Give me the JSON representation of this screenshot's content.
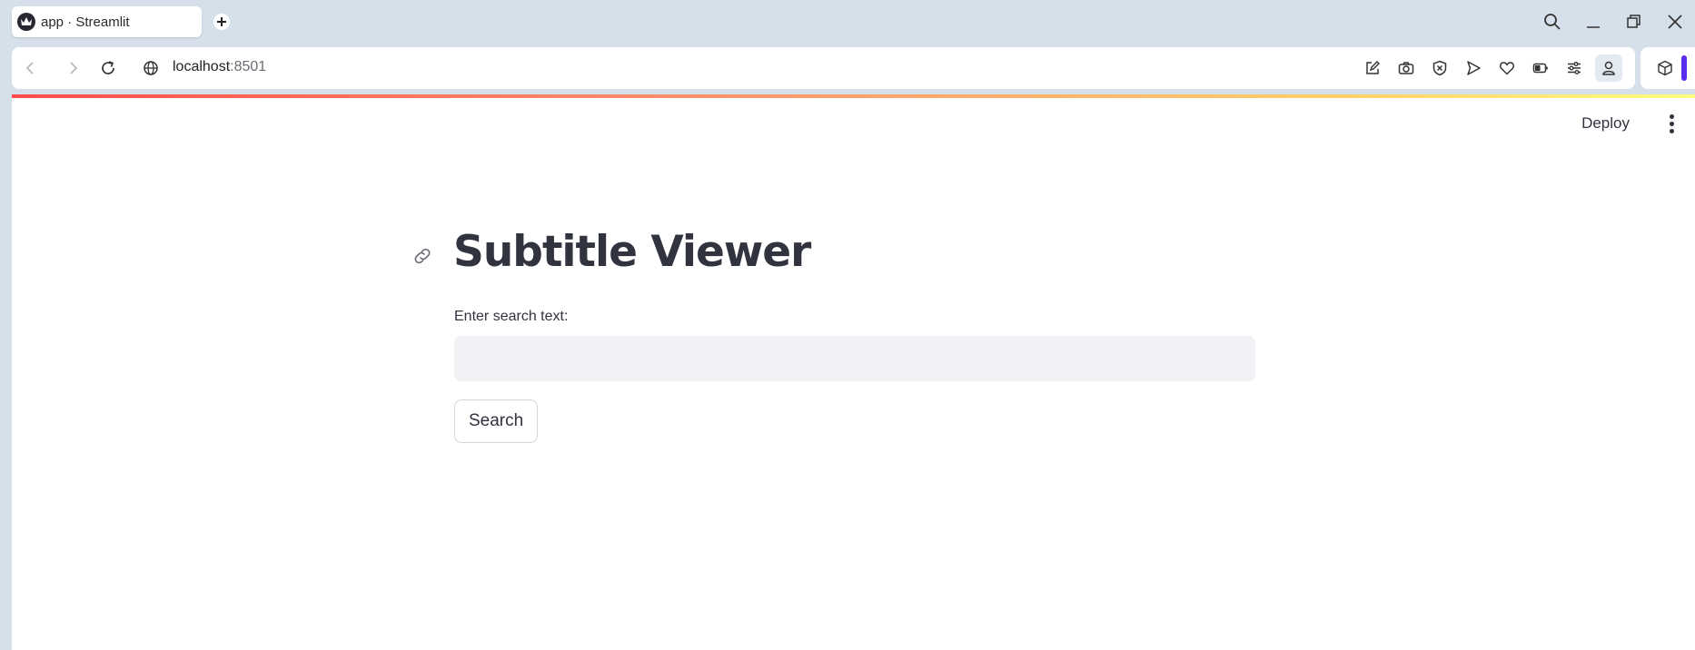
{
  "browser": {
    "tab": {
      "title": "app · Streamlit",
      "favicon": "streamlit-crown-icon"
    },
    "address_bar": {
      "host": "localhost",
      "port": ":8501"
    },
    "icons": [
      "back-arrow-icon",
      "forward-arrow-icon",
      "reload-icon",
      "globe-icon",
      "edit-icon",
      "camera-icon",
      "shield-x-icon",
      "send-icon",
      "heart-icon",
      "battery-icon",
      "sliders-icon",
      "profile-icon",
      "cube-icon",
      "search-icon",
      "minimize-icon",
      "restore-icon",
      "close-icon"
    ]
  },
  "app": {
    "header": {
      "deploy_label": "Deploy"
    },
    "title": "Subtitle Viewer",
    "search_label": "Enter search text:",
    "search_value": "",
    "search_placeholder": "",
    "button_label": "Search"
  },
  "colors": {
    "text": "#31333f",
    "input_bg": "#f0f2f6",
    "accent_gradient": [
      "#ff4b4b",
      "#fffd80"
    ],
    "extension_accent": "#5b2bf0"
  }
}
